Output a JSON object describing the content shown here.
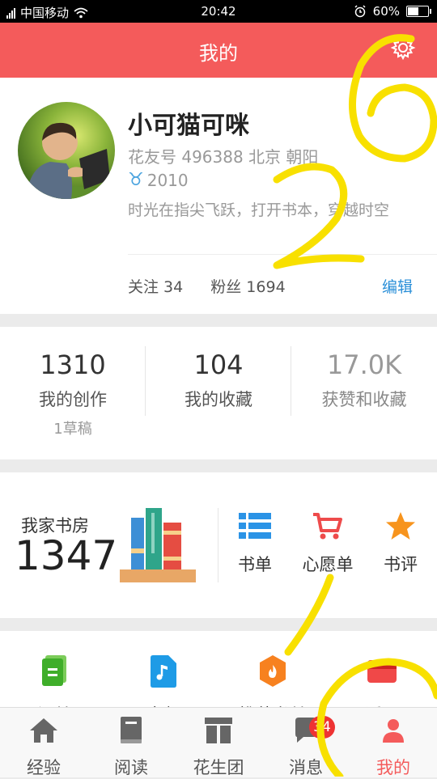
{
  "status_bar": {
    "carrier": "中国移动",
    "time": "20:42",
    "battery": "60%",
    "battery_level": 0.6
  },
  "header": {
    "title": "我的"
  },
  "profile": {
    "name": "小可猫可咪",
    "id_location": "花友号 496388   北京 朝阳",
    "zodiac_symbol": "♉",
    "zodiac_year": "2010",
    "bio": "时光在指尖飞跃，打开书本，穿越时空",
    "following": "关注 34",
    "followers": "粉丝 1694",
    "edit_label": "编辑"
  },
  "counts": [
    {
      "num": "1310",
      "label": "我的创作",
      "sub": "1草稿"
    },
    {
      "num": "104",
      "label": "我的收藏",
      "sub": ""
    },
    {
      "num": "17.0K",
      "label": "获赞和收藏",
      "sub": ""
    }
  ],
  "library": {
    "title": "我家书房",
    "count": "1347",
    "items": [
      {
        "label": "书单",
        "icon": "list-icon"
      },
      {
        "label": "心愿单",
        "icon": "cart-icon"
      },
      {
        "label": "书评",
        "icon": "star-icon"
      }
    ]
  },
  "quick_links": [
    {
      "label": "订单",
      "icon": "order-doc-icon"
    },
    {
      "label": "音频",
      "icon": "audio-file-icon"
    },
    {
      "label": "推荐书单",
      "icon": "recommend-bag-icon"
    },
    {
      "label": "返现",
      "icon": "cashback-icon"
    }
  ],
  "tabs": [
    {
      "label": "经验",
      "icon": "home-icon",
      "active": false
    },
    {
      "label": "阅读",
      "icon": "book-icon",
      "active": false
    },
    {
      "label": "花生团",
      "icon": "group-icon",
      "active": false
    },
    {
      "label": "消息",
      "icon": "message-icon",
      "active": false,
      "badge": "34"
    },
    {
      "label": "我的",
      "icon": "person-icon",
      "active": true
    }
  ],
  "annotations": {
    "number_1": "6",
    "number_2": "2"
  },
  "colors": {
    "header_bg": "#f45b5b",
    "accent_blue": "#2a8fd8",
    "active_tab": "#f45b5b",
    "annotation_yellow": "#f8e000"
  }
}
